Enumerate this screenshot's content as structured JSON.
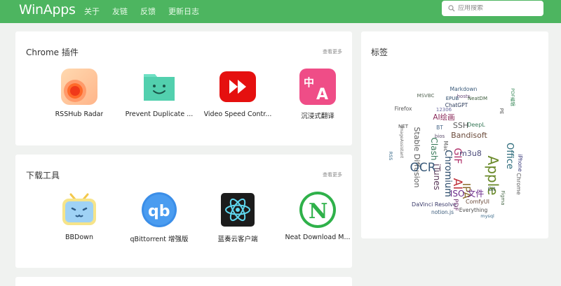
{
  "header": {
    "brand": "WinApps",
    "nav": [
      "关于",
      "友链",
      "反馈",
      "更新日志"
    ],
    "search_placeholder": "应用搜索"
  },
  "sections": [
    {
      "title": "Chrome 插件",
      "more": "查看更多",
      "apps": [
        {
          "name": "RSSHub Radar",
          "icon": "rsshub-radar-icon"
        },
        {
          "name": "Prevent Duplicate ...",
          "icon": "prevent-duplicate-icon"
        },
        {
          "name": "Video Speed Contr...",
          "icon": "video-speed-controller-icon"
        },
        {
          "name": "沉浸式翻译",
          "icon": "immersive-translate-icon"
        }
      ]
    },
    {
      "title": "下载工具",
      "more": "查看更多",
      "apps": [
        {
          "name": "BBDown",
          "icon": "bbdown-icon"
        },
        {
          "name": "qBittorrent 增强版",
          "icon": "qbittorrent-icon"
        },
        {
          "name": "蓝奏云客户端",
          "icon": "lanzou-client-icon"
        },
        {
          "name": "Neat Download M...",
          "icon": "neat-download-manager-icon"
        }
      ]
    }
  ],
  "tags": {
    "title": "标签",
    "words": [
      "Markdown",
      "hosts",
      "MSVBC",
      "EPUB",
      "NeatDM",
      "PDF编辑",
      "Firefox",
      "12306",
      "ChatGPT",
      "PE",
      "AI绘画",
      "SSH",
      "DeepL",
      "Bandisoft",
      "GIF",
      "AI",
      "Apple",
      "m3u8",
      "Office",
      "Chromium",
      "Stable Diffusion",
      "OCR",
      "iTunes",
      "IPA",
      "ISO 文件",
      "DaVinci Resolve",
      "ComfyUI",
      "Everything",
      "notion.js",
      "mysql",
      "Photoshop",
      "RSS",
      "NET",
      "Clash",
      "ImageAssistant",
      "Git",
      "Chrome",
      "BT",
      "bios",
      "Mac",
      "iPhone",
      "Figma",
      "PDF"
    ]
  },
  "colors": {
    "header": "#4db560",
    "background": "#f0f2f0"
  }
}
